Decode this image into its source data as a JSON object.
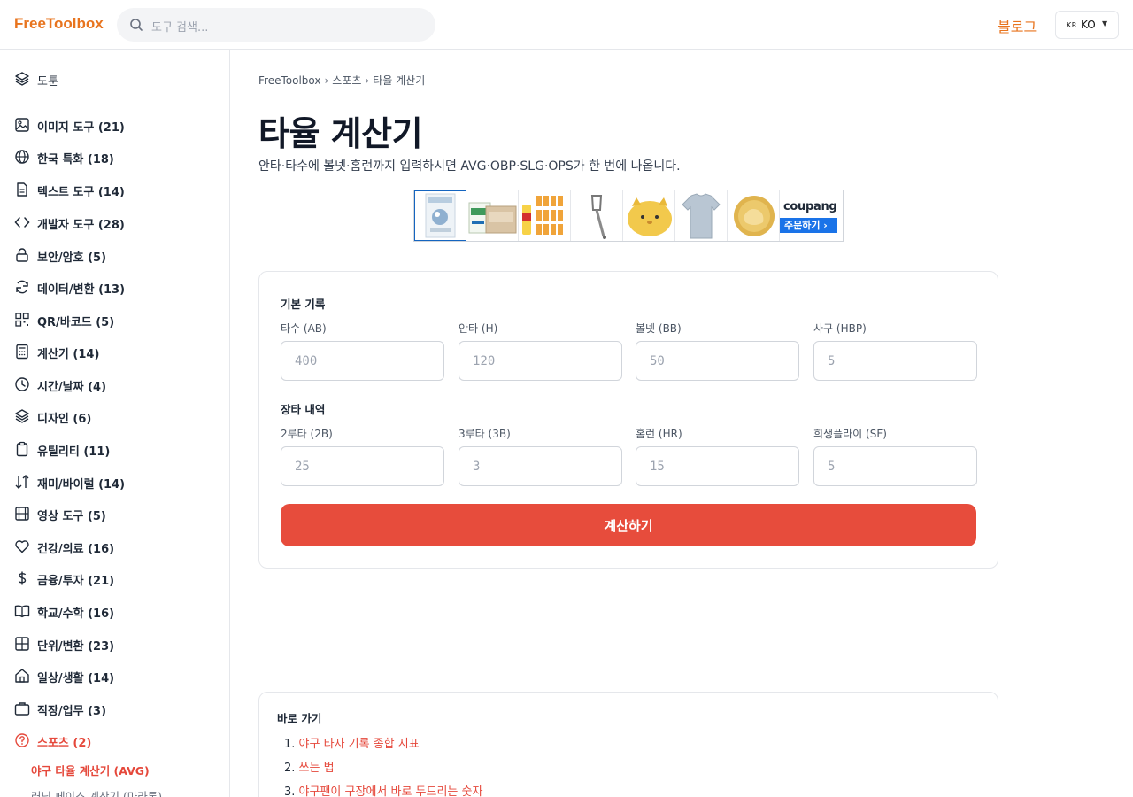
{
  "header": {
    "logo": "FreeToolbox",
    "search_placeholder": "도구 검색...",
    "blog": "블로그",
    "lang_flag": "KR",
    "lang_code": "KO"
  },
  "sidebar": {
    "top_item": "도툰",
    "items": [
      {
        "label": "이미지 도구 (21)",
        "icon": "image-icon"
      },
      {
        "label": "한국 특화 (18)",
        "icon": "globe-icon"
      },
      {
        "label": "텍스트 도구 (14)",
        "icon": "document-icon"
      },
      {
        "label": "개발자 도구 (28)",
        "icon": "code-icon"
      },
      {
        "label": "보안/암호 (5)",
        "icon": "lock-icon"
      },
      {
        "label": "데이터/변환 (13)",
        "icon": "refresh-icon"
      },
      {
        "label": "QR/바코드 (5)",
        "icon": "qr-icon"
      },
      {
        "label": "계산기 (14)",
        "icon": "calculator-icon"
      },
      {
        "label": "시간/날짜 (4)",
        "icon": "clock-icon"
      },
      {
        "label": "디자인 (6)",
        "icon": "layers-icon"
      },
      {
        "label": "유틸리티 (11)",
        "icon": "clipboard-icon"
      },
      {
        "label": "재미/바이럴 (14)",
        "icon": "shuffle-icon"
      },
      {
        "label": "영상 도구 (5)",
        "icon": "film-icon"
      },
      {
        "label": "건강/의료 (16)",
        "icon": "heart-icon"
      },
      {
        "label": "금융/투자 (21)",
        "icon": "dollar-icon"
      },
      {
        "label": "학교/수학 (16)",
        "icon": "book-icon"
      },
      {
        "label": "단위/변환 (23)",
        "icon": "grid-icon"
      },
      {
        "label": "일상/생활 (14)",
        "icon": "home-icon"
      },
      {
        "label": "직장/업무 (3)",
        "icon": "briefcase-icon"
      },
      {
        "label": "스포츠 (2)",
        "icon": "help-circle-icon"
      }
    ],
    "sub_items": [
      "야구 타율 계산기 (AVG)",
      "러닝 페이스 계산기 (마라톤)"
    ]
  },
  "breadcrumb": {
    "home": "FreeToolbox",
    "category": "스포츠",
    "current": "타율 계산기"
  },
  "page": {
    "title": "타율 계산기",
    "subtitle": "안타·타수에 볼넷·홈런까지 입력하시면 AVG·OBP·SLG·OPS가 한 번에 나옵니다."
  },
  "ad": {
    "brand": "coupang",
    "cta": "주문하기 ›"
  },
  "form": {
    "section1_title": "기본 기록",
    "section2_title": "장타 내역",
    "fields_row1": [
      {
        "label": "타수 (AB)",
        "placeholder": "400"
      },
      {
        "label": "안타 (H)",
        "placeholder": "120"
      },
      {
        "label": "볼넷 (BB)",
        "placeholder": "50"
      },
      {
        "label": "사구 (HBP)",
        "placeholder": "5"
      }
    ],
    "fields_row2": [
      {
        "label": "2루타 (2B)",
        "placeholder": "25"
      },
      {
        "label": "3루타 (3B)",
        "placeholder": "3"
      },
      {
        "label": "홈런 (HR)",
        "placeholder": "15"
      },
      {
        "label": "희생플라이 (SF)",
        "placeholder": "5"
      }
    ],
    "submit": "계산하기"
  },
  "toc": {
    "title": "바로 가기",
    "items": [
      "야구 타자 기록 종합 지표",
      "쓰는 법",
      "야구팬이 구장에서 바로 두드리는 숫자"
    ]
  },
  "colors": {
    "brand": "#e8741e",
    "accent": "#e74c3c"
  }
}
